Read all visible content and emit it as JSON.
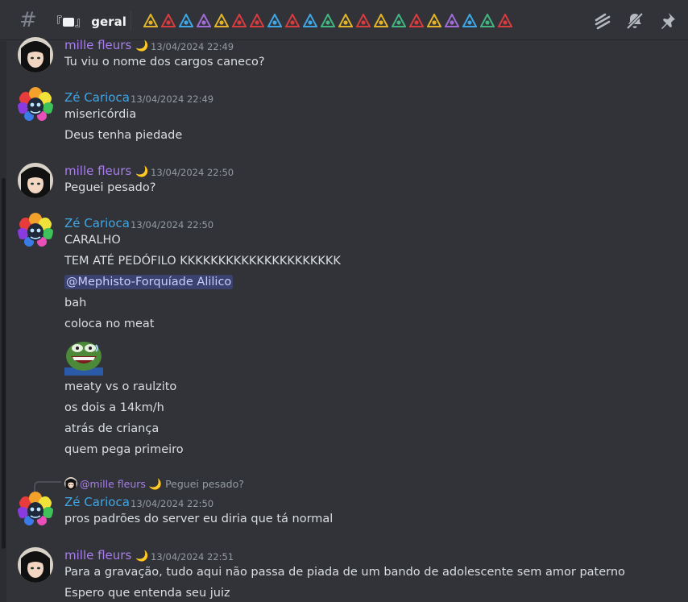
{
  "header": {
    "channel_prefix": "『",
    "channel_suffix": "』",
    "channel_name": "geral",
    "channel_icon": "speech-bubble-icon",
    "topic_icons": [
      "#e3b32a",
      "#d83c3e",
      "#3fa7e6",
      "#a06cd5",
      "#e3b32a",
      "#d83c3e",
      "#d83c3e",
      "#3fa7e6",
      "#d83c3e",
      "#3fa7e6",
      "#43b581",
      "#e3b32a",
      "#d83c3e",
      "#e3b32a",
      "#43b581",
      "#d83c3e",
      "#e3b32a",
      "#a06cd5",
      "#3fa7e6",
      "#43b581",
      "#d83c3e"
    ],
    "toolbar_icons": [
      "threads-icon",
      "mute-bell-icon",
      "pin-icon"
    ]
  },
  "colors": {
    "background": "#313338",
    "mille_name": "#a97cf0",
    "ze_name": "#3fa7e6",
    "mention_bg": "#3c4270"
  },
  "messages": [
    {
      "author": "mille fleurs",
      "moon": "🌙",
      "timestamp": "13/04/2024 22:49",
      "lines": [
        "Tu viu o nome dos cargos caneco?"
      ]
    },
    {
      "author": "Zé Carioca",
      "timestamp": "13/04/2024 22:49",
      "lines": [
        "misericórdia",
        "Deus tenha piedade"
      ]
    },
    {
      "author": "mille fleurs",
      "moon": "🌙",
      "timestamp": "13/04/2024 22:50",
      "lines": [
        "Peguei pesado?"
      ]
    },
    {
      "author": "Zé Carioca",
      "timestamp": "13/04/2024 22:50",
      "lines": [
        "CARALHO",
        "TEM ATÉ PEDÓFILO KKKKKKKKKKKKKKKKKKKKK",
        "@Mephisto-Forquíade Alilico",
        "bah",
        "coloca no meat",
        "meaty vs o raulzito",
        "os dois a 14km/h",
        "atrás de criança",
        "quem pega primeiro"
      ]
    },
    {
      "reply_to": "@mille fleurs",
      "reply_moon": "🌙",
      "reply_text": "Peguei pesado?",
      "author": "Zé Carioca",
      "timestamp": "13/04/2024 22:50",
      "lines": [
        "pros padrões do server eu diria que tá normal"
      ]
    },
    {
      "author": "mille fleurs",
      "moon": "🌙",
      "timestamp": "13/04/2024 22:51",
      "lines": [
        "Para a gravação, tudo aqui não passa de piada de um bando de adolescente sem amor paterno",
        "Espero que entenda seu juiz"
      ]
    }
  ]
}
